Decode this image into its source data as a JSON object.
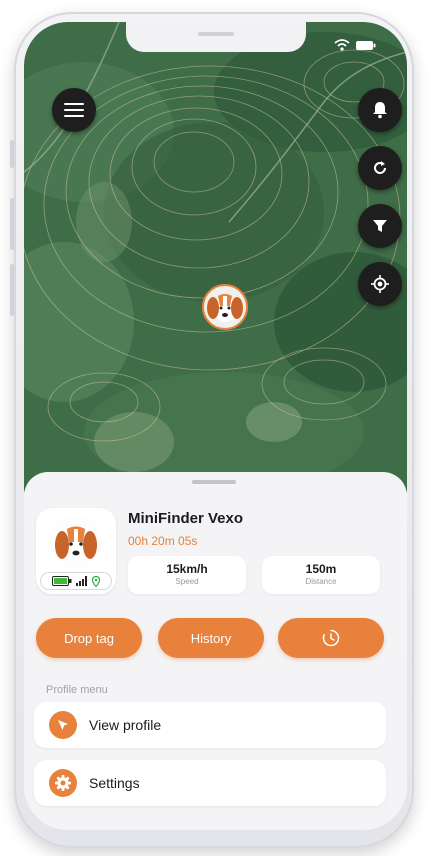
{
  "map": {
    "buttons": {
      "menu": "hamburger-menu-icon",
      "notifications": "bell-icon",
      "refresh": "refresh-icon",
      "filter": "filter-icon",
      "locate": "crosshair-icon"
    },
    "marker": "beagle-dog-icon"
  },
  "status_bar": {
    "icons": [
      "wifi-icon",
      "battery-icon"
    ]
  },
  "pet": {
    "name": "MiniFinder Vexo",
    "elapsed": "00h 20m 05s",
    "device_status_icons": [
      "battery-icon",
      "signal-bars-icon",
      "gps-pin-icon"
    ]
  },
  "stats": [
    {
      "value": "15km/h",
      "label": "Speed"
    },
    {
      "value": "150m",
      "label": "Distance"
    }
  ],
  "actions": {
    "drop_tag": "Drop tag",
    "history": "History",
    "timer_icon": "clock-icon"
  },
  "profile_menu": {
    "title": "Profile menu",
    "items": [
      {
        "label": "View profile",
        "icon": "paw-pin-icon"
      },
      {
        "label": "Settings",
        "icon": "gear-icon"
      }
    ]
  },
  "colors": {
    "accent": "#e7813b",
    "map_button": "#1e1e1e",
    "sheet_background": "#f4f4f6",
    "map_green": "#3d6b44"
  }
}
